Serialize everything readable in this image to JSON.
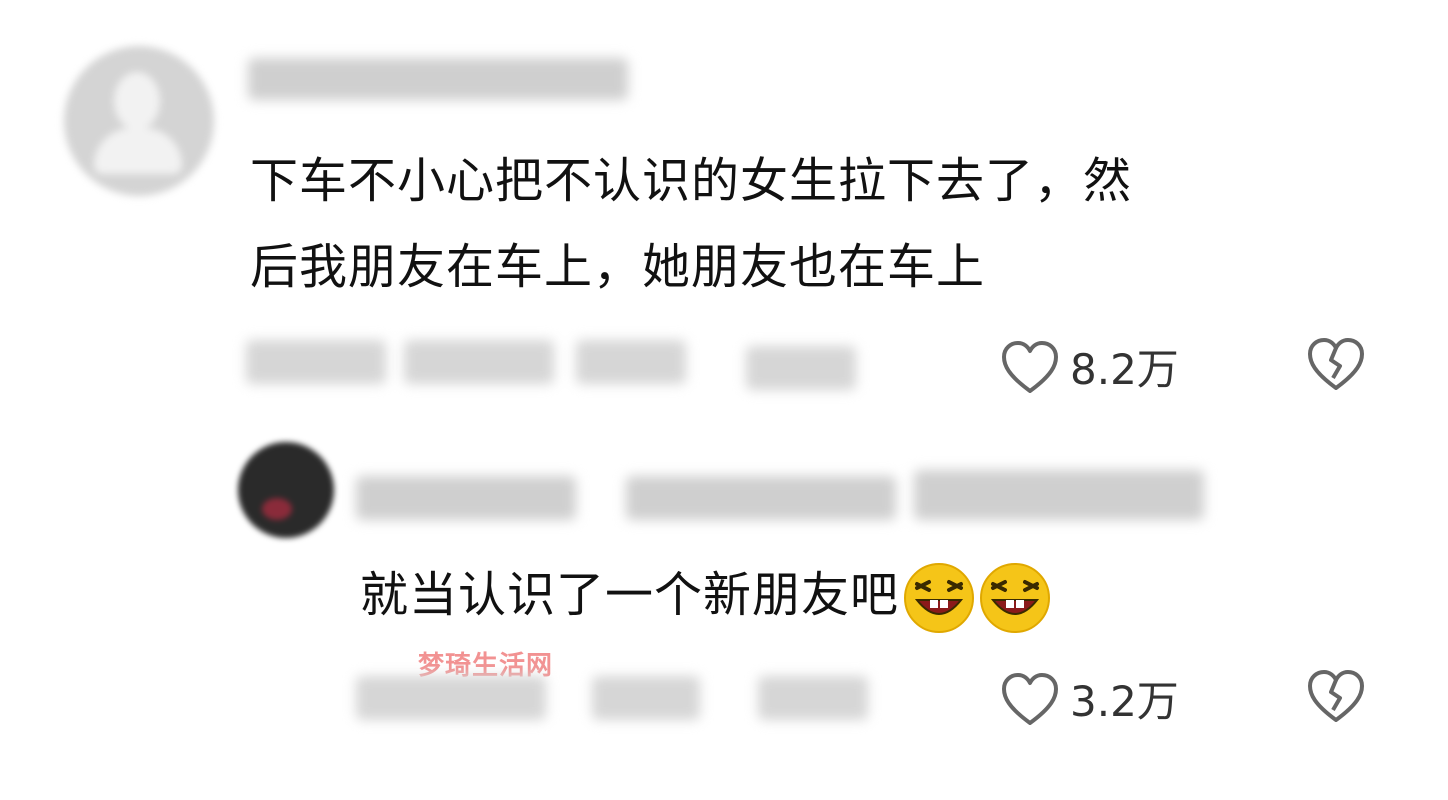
{
  "comments": [
    {
      "text_line1": "下车不小心把不认识的女生拉下去了，然",
      "text_line2": "后我朋友在车上，她朋友也在车上",
      "likes": "8.2万",
      "icons": {
        "like": "heart-outline-icon",
        "dislike": "broken-heart-icon"
      }
    },
    {
      "text": "就当认识了一个新朋友吧",
      "emojis": [
        "laughing-face-emoji",
        "laughing-face-emoji"
      ],
      "likes": "3.2万",
      "icons": {
        "like": "heart-outline-icon",
        "dislike": "broken-heart-icon"
      }
    }
  ],
  "watermark": "梦琦生活网",
  "colors": {
    "text": "#111111",
    "count": "#333333",
    "watermark": "#f08080",
    "icon": "#666666",
    "emoji": "#f5c518"
  }
}
